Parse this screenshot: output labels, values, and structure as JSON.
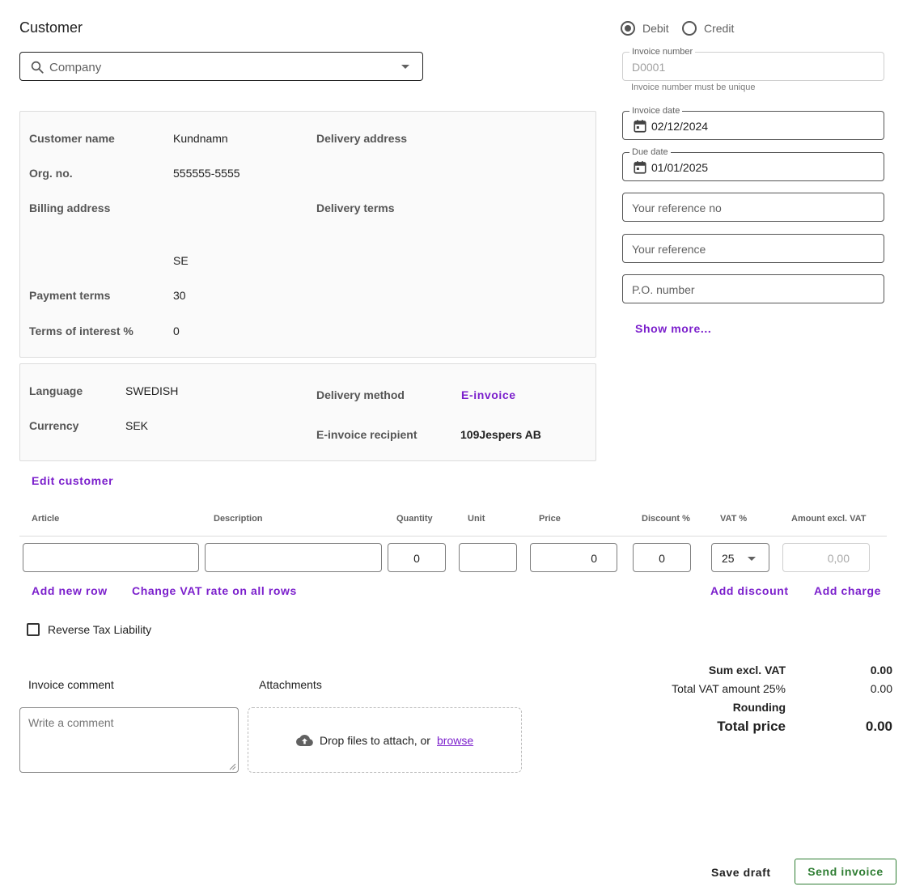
{
  "customer": {
    "title": "Customer",
    "company_placeholder": "Company"
  },
  "customer_info": {
    "customer_name_label": "Customer name",
    "customer_name_value": "Kundnamn",
    "org_no_label": "Org. no.",
    "org_no_value": "555555-5555",
    "billing_address_label": "Billing address",
    "billing_country": "SE",
    "payment_terms_label": "Payment terms",
    "payment_terms_value": "30",
    "terms_of_interest_label": "Terms of interest %",
    "terms_of_interest_value": "0",
    "delivery_address_label": "Delivery address",
    "delivery_terms_label": "Delivery terms"
  },
  "customer_settings": {
    "language_label": "Language",
    "language_value": "SWEDISH",
    "currency_label": "Currency",
    "currency_value": "SEK",
    "delivery_method_label": "Delivery method",
    "delivery_method_value": "E-invoice",
    "einvoice_recipient_label": "E-invoice recipient",
    "einvoice_recipient_value": "109Jespers AB"
  },
  "edit_customer_label": "Edit customer",
  "invoice_type": {
    "debit_label": "Debit",
    "credit_label": "Credit",
    "selected": "Debit"
  },
  "invoice_fields": {
    "invoice_number_legend": "Invoice number",
    "invoice_number_value": "D0001",
    "invoice_number_helper": "Invoice number must be unique",
    "invoice_date_legend": "Invoice date",
    "invoice_date_value": "02/12/2024",
    "due_date_legend": "Due date",
    "due_date_value": "01/01/2025",
    "reference_no_placeholder": "Your reference no",
    "reference_placeholder": "Your reference",
    "po_number_placeholder": "P.O. number",
    "show_more_label": "Show more..."
  },
  "table": {
    "headers": {
      "article": "Article",
      "description": "Description",
      "quantity": "Quantity",
      "unit": "Unit",
      "price": "Price",
      "discount": "Discount %",
      "vat": "VAT %",
      "amount": "Amount excl. VAT"
    },
    "row": {
      "article": "",
      "description": "",
      "quantity": "0",
      "unit": "",
      "price": "0",
      "discount": "0",
      "vat": "25",
      "amount": "0,00"
    },
    "add_row_label": "Add new row",
    "change_vat_label": "Change VAT rate on all rows",
    "add_discount_label": "Add discount",
    "add_charge_label": "Add charge"
  },
  "reverse_tax_label": "Reverse Tax Liability",
  "comment": {
    "title": "Invoice comment",
    "placeholder": "Write a comment"
  },
  "attachments": {
    "title": "Attachments",
    "drop_text": "Drop files to attach, or",
    "browse_link": "browse"
  },
  "summary": {
    "sum_excl_vat_label": "Sum excl. VAT",
    "sum_excl_vat_value": "0.00",
    "total_vat_label": "Total VAT amount 25%",
    "total_vat_value": "0.00",
    "rounding_label": "Rounding",
    "total_price_label": "Total price",
    "total_price_value": "0.00"
  },
  "actions": {
    "save_draft_label": "Save draft",
    "send_invoice_label": "Send invoice"
  },
  "colors": {
    "link": "#7b1fcc",
    "send_button": "#2e7d32"
  }
}
